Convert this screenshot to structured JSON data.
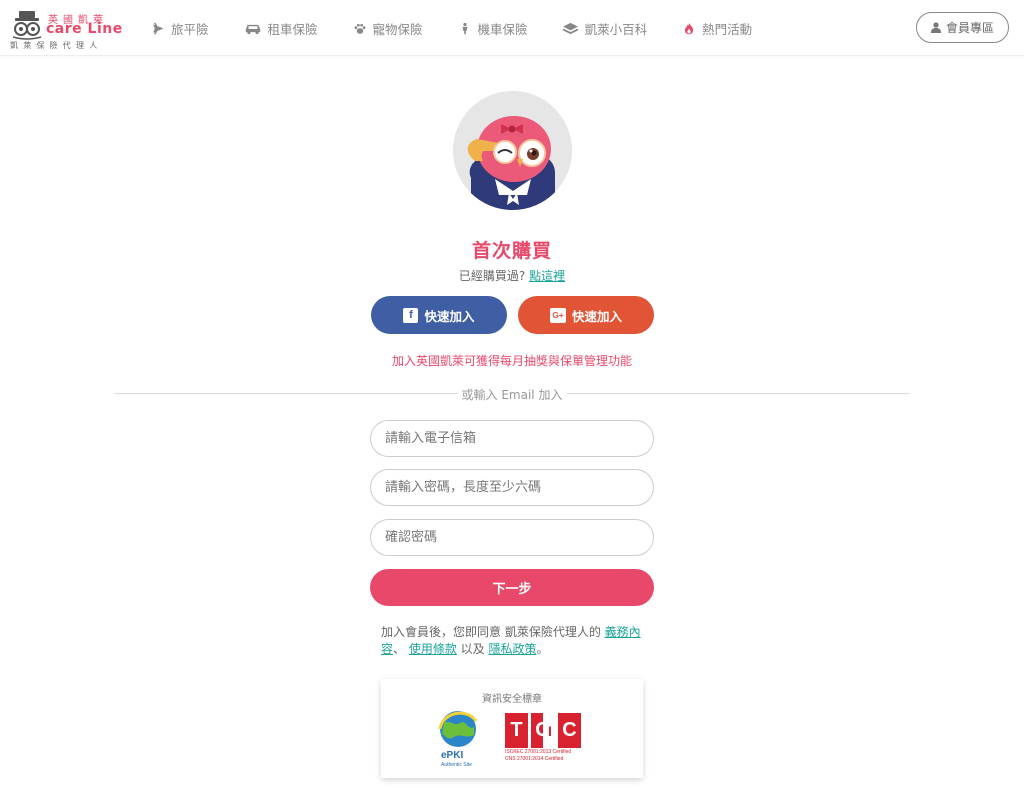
{
  "header": {
    "logo": {
      "top_text": "英國凱萊",
      "brand": "care Line",
      "sub_text": "凱萊保險代理人"
    },
    "nav": [
      {
        "label": "旅平險",
        "icon": "airplane-icon"
      },
      {
        "label": "租車保險",
        "icon": "car-icon"
      },
      {
        "label": "寵物保險",
        "icon": "paw-icon"
      },
      {
        "label": "機車保險",
        "icon": "scooter-icon"
      },
      {
        "label": "凱萊小百科",
        "icon": "book-icon"
      },
      {
        "label": "熱門活動",
        "icon": "fire-icon"
      }
    ],
    "member_button": {
      "label": "會員專區",
      "icon": "user-icon"
    }
  },
  "main": {
    "avatar": "owl-mascot-avatar",
    "title": "首次購買",
    "already_text": "已經購買過?",
    "already_link": "點這裡",
    "facebook_button": {
      "label": "快速加入",
      "icon": "facebook-icon"
    },
    "google_button": {
      "label": "快速加入",
      "icon": "google-plus-icon"
    },
    "promo_text": "加入英國凱萊可獲得每月抽獎與保單管理功能",
    "divider_text": "或輸入 Email 加入",
    "form": {
      "email_placeholder": "請輸入電子信箱",
      "password_placeholder": "請輸入密碼，長度至少六碼",
      "confirm_placeholder": "確認密碼",
      "next_button": "下一步"
    },
    "terms": {
      "prefix": "加入會員後，您即同意 凱萊保險代理人的 ",
      "link1": "義務內容",
      "sep1": "、 ",
      "link2": "使用條款",
      "sep2": " 以及 ",
      "link3": "隱私政策",
      "suffix": "。"
    },
    "security": {
      "title": "資訊安全標章",
      "epki_label": "ePKI",
      "epki_sub": "Authentic Site",
      "tcic_letters": [
        "T",
        "C",
        "I",
        "C"
      ],
      "tcic_line1": "ISO/IEC 27001:2013 Certified",
      "tcic_line2": "CNS 27001:2014 Certified"
    }
  },
  "colors": {
    "accent": "#e8496a",
    "link": "#1aa39a",
    "facebook": "#3f5ea3",
    "google": "#e25436"
  }
}
